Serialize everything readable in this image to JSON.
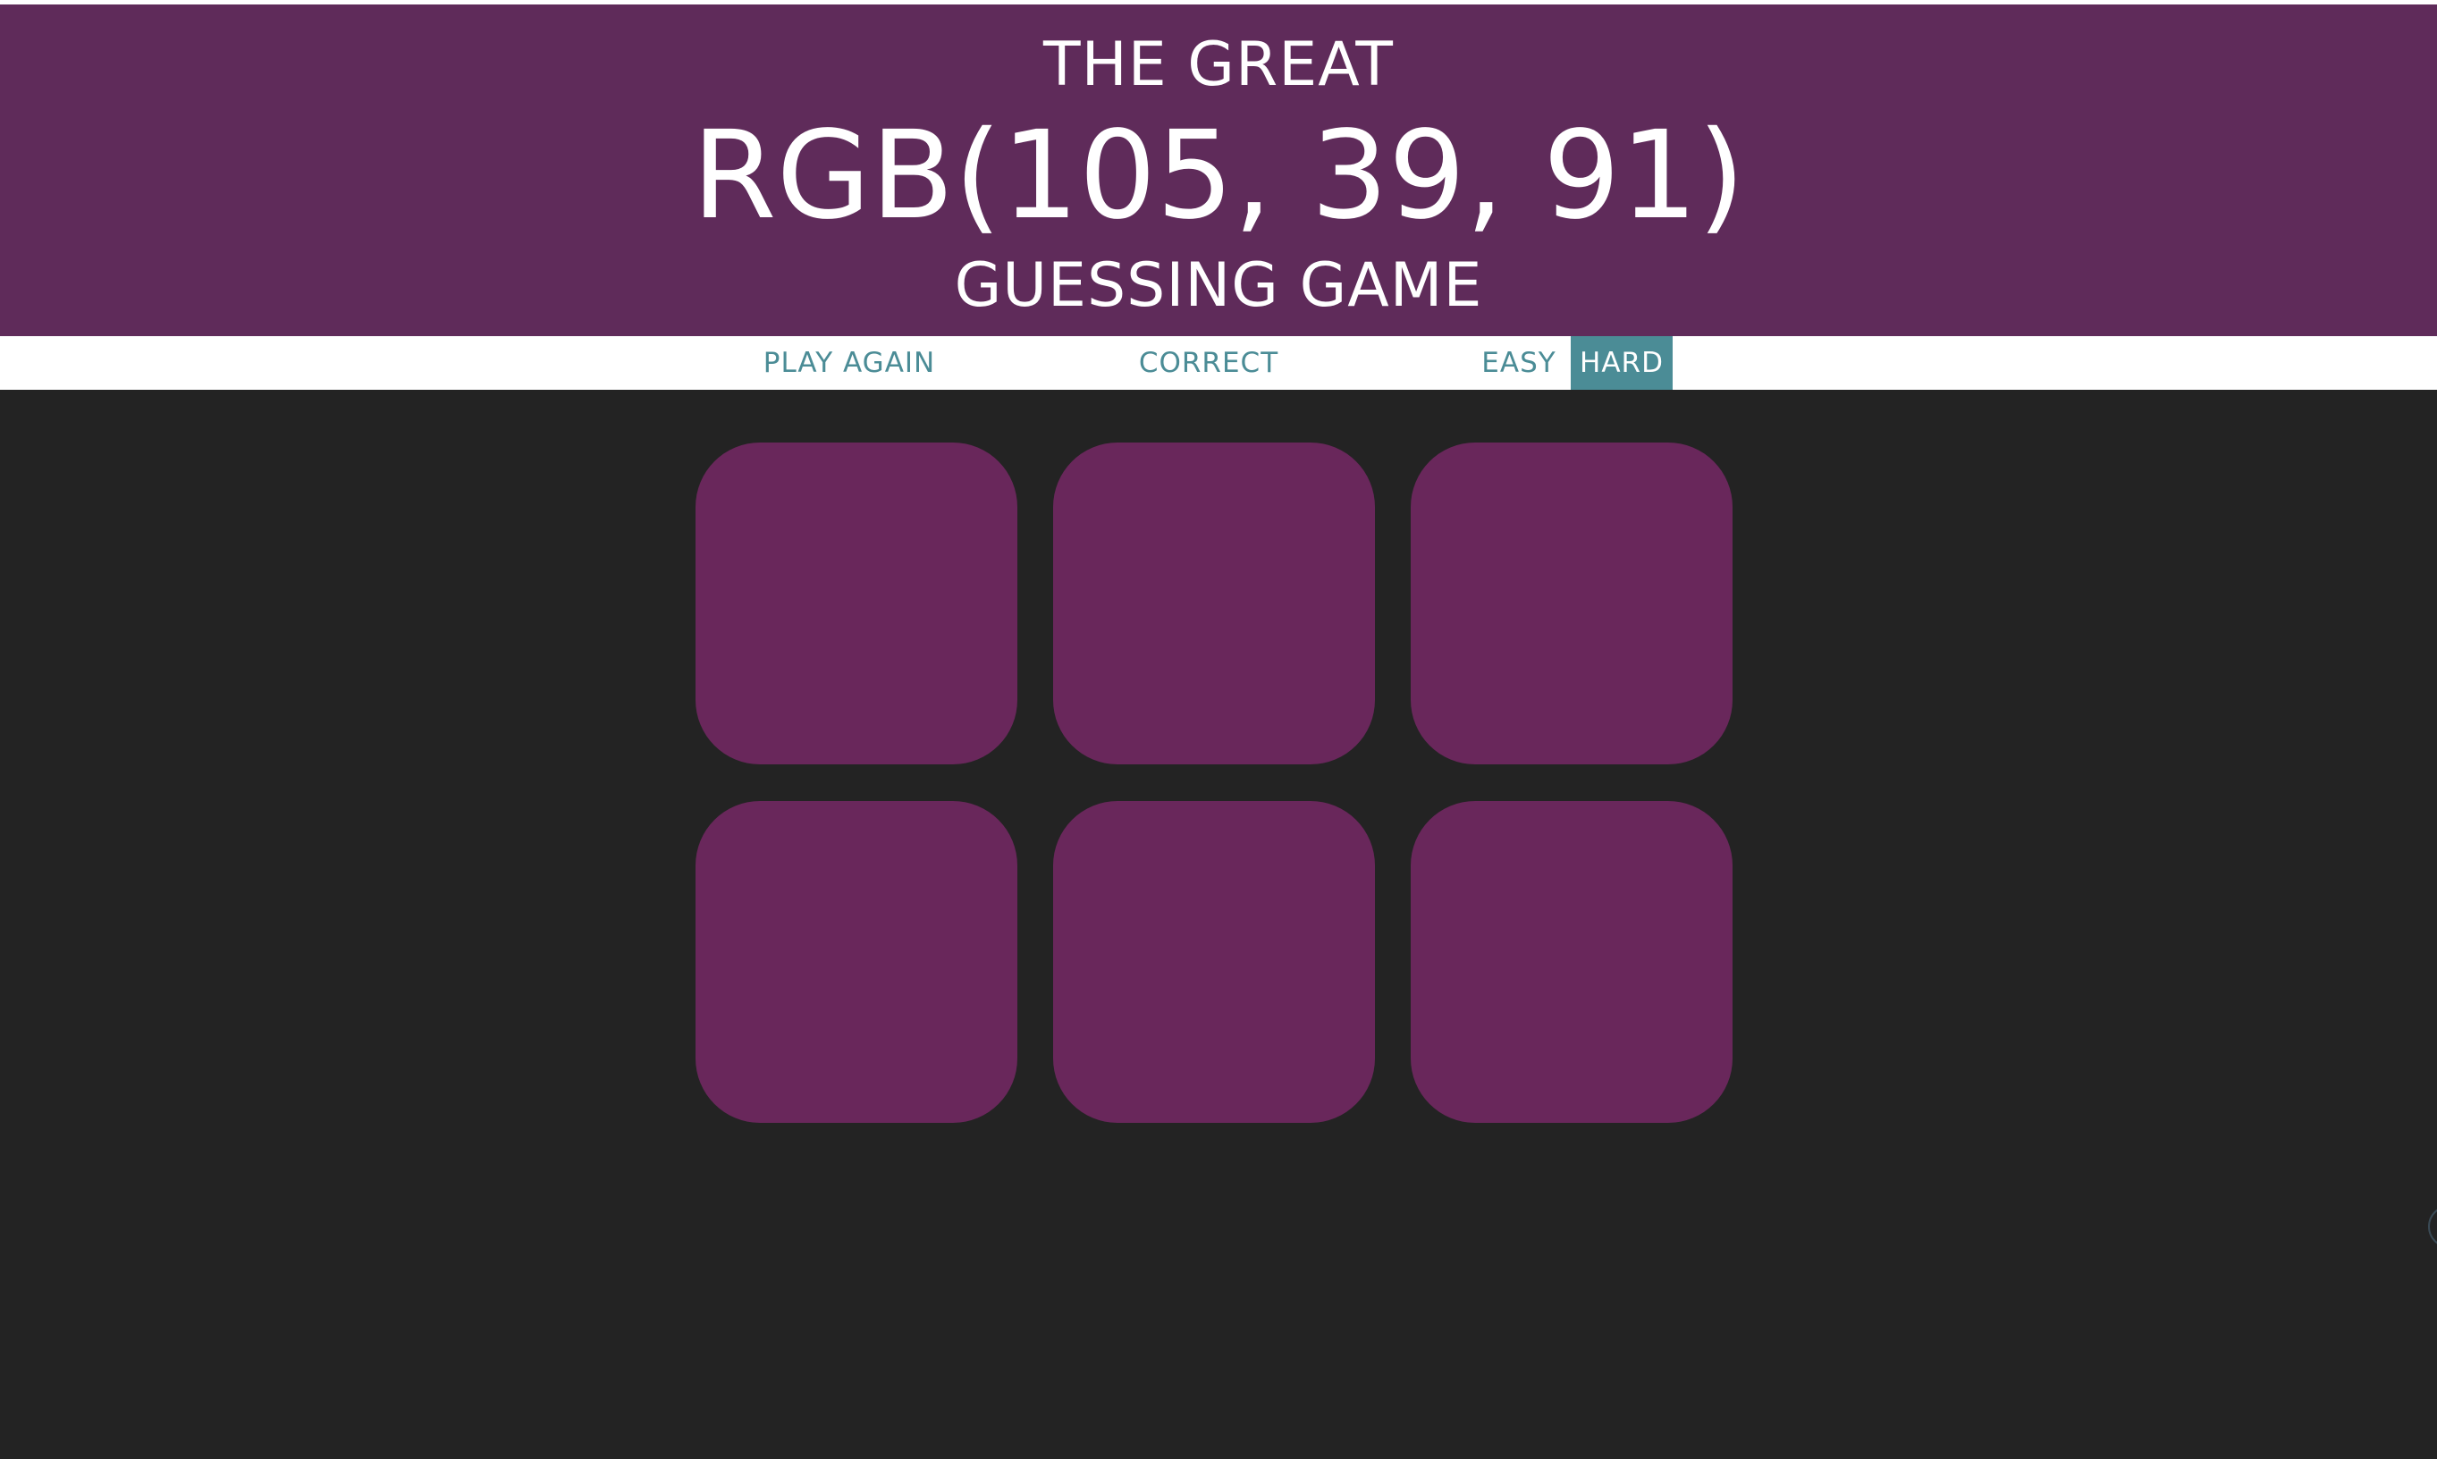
{
  "header": {
    "line1": "THE GREAT",
    "rgb_display": "RGB(105, 39, 91)",
    "line3": "GUESSING GAME",
    "background_color": "#5f2b5a"
  },
  "stripe": {
    "play_again_label": "PLAY AGAIN",
    "message": "CORRECT",
    "easy_label": "EASY",
    "hard_label": "HARD",
    "selected_mode": "HARD",
    "accent_color": "#4b8c96"
  },
  "board": {
    "background_color": "#232323",
    "squares": [
      {
        "color": "rgb(105, 39, 91)"
      },
      {
        "color": "rgb(105, 39, 91)"
      },
      {
        "color": "rgb(105, 39, 91)"
      },
      {
        "color": "rgb(105, 39, 91)"
      },
      {
        "color": "rgb(105, 39, 91)"
      },
      {
        "color": "rgb(105, 39, 91)"
      }
    ]
  }
}
